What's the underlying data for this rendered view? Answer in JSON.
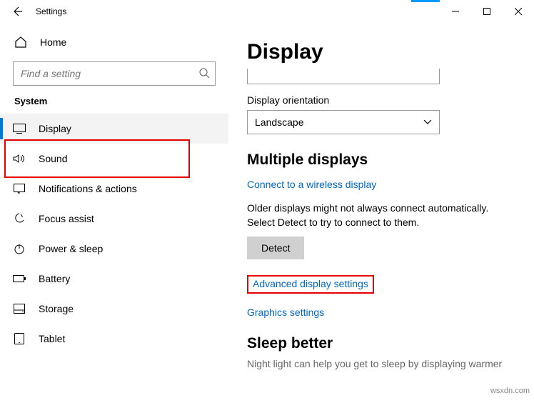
{
  "titlebar": {
    "title": "Settings"
  },
  "sidebar": {
    "home": "Home",
    "search_placeholder": "Find a setting",
    "category": "System",
    "items": [
      {
        "label": "Display"
      },
      {
        "label": "Sound"
      },
      {
        "label": "Notifications & actions"
      },
      {
        "label": "Focus assist"
      },
      {
        "label": "Power & sleep"
      },
      {
        "label": "Battery"
      },
      {
        "label": "Storage"
      },
      {
        "label": "Tablet"
      }
    ]
  },
  "main": {
    "heading": "Display",
    "orientation_label": "Display orientation",
    "orientation_value": "Landscape",
    "multi_heading": "Multiple displays",
    "wireless_link": "Connect to a wireless display",
    "detect_text": "Older displays might not always connect automatically. Select Detect to try to connect to them.",
    "detect_btn": "Detect",
    "advanced_link": "Advanced display settings",
    "graphics_link": "Graphics settings",
    "sleep_heading": "Sleep better",
    "sleep_text": "Night light can help you get to sleep by displaying warmer"
  },
  "watermark": "wsxdn.com"
}
